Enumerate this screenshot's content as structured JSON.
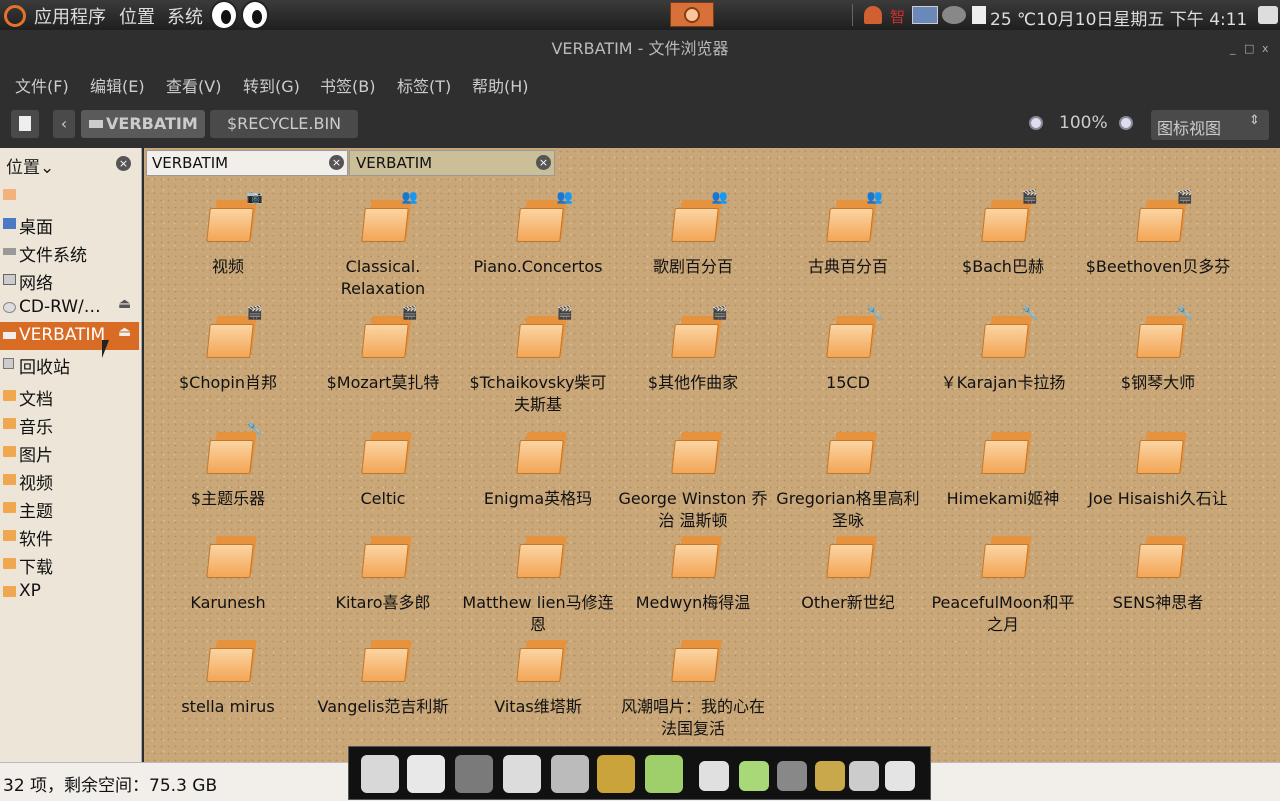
{
  "top_panel": {
    "menus": [
      "应用程序",
      "位置",
      "系统"
    ],
    "clock": "25 ℃10月10日星期五 下午 4:11",
    "tray_label": "智"
  },
  "window": {
    "title": "VERBATIM - 文件浏览器",
    "controls": [
      "_",
      "□",
      "x"
    ]
  },
  "menubar": [
    "文件(F)",
    "编辑(E)",
    "查看(V)",
    "转到(G)",
    "书签(B)",
    "标签(T)",
    "帮助(H)"
  ],
  "toolbar": {
    "path": [
      "VERBATIM",
      "$RECYCLE.BIN"
    ],
    "zoom": "100%",
    "view_mode": "图标视图"
  },
  "sidebar": {
    "header": "位置",
    "items": [
      {
        "label": "",
        "icon": "home-icon"
      },
      {
        "label": "桌面",
        "icon": "desktop-icon"
      },
      {
        "label": "文件系统",
        "icon": "drive-icon"
      },
      {
        "label": "网络",
        "icon": "network-icon"
      },
      {
        "label": "CD-RW/…",
        "icon": "cdrom-icon"
      },
      {
        "label": "VERBATIM",
        "icon": "usb-drive-icon"
      },
      {
        "label": "回收站",
        "icon": "trash-icon"
      }
    ],
    "bookmarks": [
      "文档",
      "音乐",
      "图片",
      "视频",
      "主题",
      "软件",
      "下载",
      "XP"
    ]
  },
  "tabs": [
    {
      "label": "VERBATIM"
    },
    {
      "label": "VERBATIM"
    }
  ],
  "files": [
    {
      "name": "视频",
      "emblem": "camera"
    },
    {
      "name": "Classical. Relaxation",
      "emblem": "people"
    },
    {
      "name": "Piano.Concertos",
      "emblem": "people"
    },
    {
      "name": "歌剧百分百",
      "emblem": "people"
    },
    {
      "name": "古典百分百",
      "emblem": "people"
    },
    {
      "name": "$Bach巴赫",
      "emblem": "film"
    },
    {
      "name": "$Beethoven贝多芬",
      "emblem": "film"
    },
    {
      "name": "$Chopin肖邦",
      "emblem": "film"
    },
    {
      "name": "$Mozart莫扎特",
      "emblem": "film"
    },
    {
      "name": "$Tchaikovsky柴可夫斯基",
      "emblem": "film"
    },
    {
      "name": "$其他作曲家",
      "emblem": "film"
    },
    {
      "name": "15CD",
      "emblem": "tools"
    },
    {
      "name": "￥Karajan卡拉扬",
      "emblem": "tools"
    },
    {
      "name": "$钢琴大师",
      "emblem": "tools"
    },
    {
      "name": "$主题乐器",
      "emblem": "tools"
    },
    {
      "name": "Celtic",
      "emblem": ""
    },
    {
      "name": "Enigma英格玛",
      "emblem": ""
    },
    {
      "name": "George Winston 乔治 温斯顿",
      "emblem": ""
    },
    {
      "name": "Gregorian格里高利圣咏",
      "emblem": ""
    },
    {
      "name": "Himekami姬神",
      "emblem": ""
    },
    {
      "name": "Joe Hisaishi久石让",
      "emblem": ""
    },
    {
      "name": "Karunesh",
      "emblem": ""
    },
    {
      "name": "Kitaro喜多郎",
      "emblem": ""
    },
    {
      "name": "Matthew lien马修连恩",
      "emblem": ""
    },
    {
      "name": "Medwyn梅得温",
      "emblem": ""
    },
    {
      "name": "Other新世纪",
      "emblem": ""
    },
    {
      "name": "PeacefulMoon和平之月",
      "emblem": ""
    },
    {
      "name": "SENS神思者",
      "emblem": ""
    },
    {
      "name": "stella mirus",
      "emblem": ""
    },
    {
      "name": "Vangelis范吉利斯",
      "emblem": ""
    },
    {
      "name": "Vitas维塔斯",
      "emblem": ""
    },
    {
      "name": "风潮唱片：我的心在法国复活",
      "emblem": ""
    }
  ],
  "status": "32 项，剩余空间：75.3 GB",
  "dock_icons": [
    "tux-icon",
    "tux-pen-icon",
    "monitor-icon",
    "tux-icon",
    "clock-icon",
    "music-disc-icon",
    "tux-chat-icon",
    "keys-icon",
    "tux-chat-icon",
    "monitor-icon",
    "music-disc-icon",
    "clock-icon",
    "tux-icon"
  ]
}
